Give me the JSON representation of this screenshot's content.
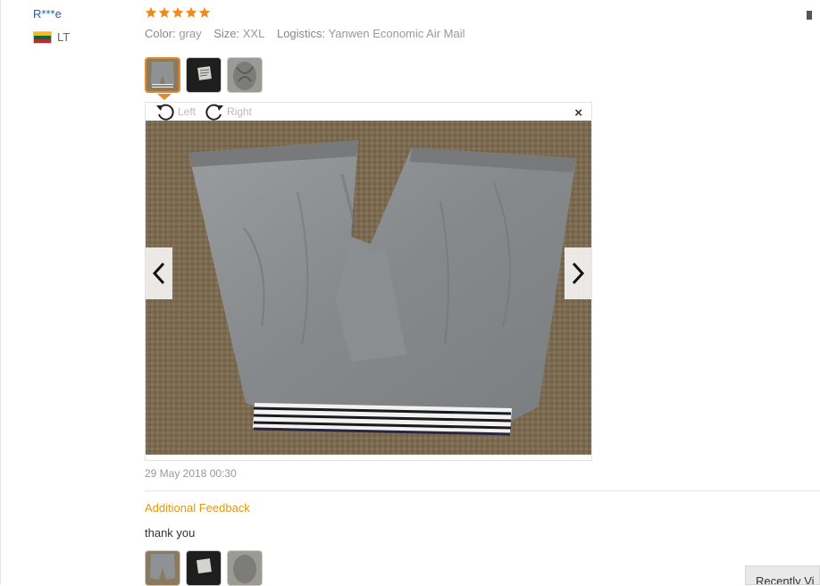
{
  "review": {
    "user_name": "R***e",
    "country_code": "LT",
    "rating_stars": 5,
    "color_label": "Color:",
    "color_value": "gray",
    "size_label": "Size:",
    "size_value": "XXL",
    "logistics_label": "Logistics:",
    "logistics_value": "Yanwen Economic Air Mail",
    "date": "29 May 2018 00:30"
  },
  "viewer": {
    "rotate_left_label": "Left",
    "rotate_right_label": "Right",
    "close_glyph": "×"
  },
  "additional_feedback": {
    "heading": "Additional Feedback",
    "text": "thank you"
  },
  "recently_viewed": {
    "label": "Recently Vi"
  },
  "colors": {
    "accent_orange": "#e58a2b",
    "star_orange": "#f08a1e",
    "username_blue": "#1e5fa8",
    "feedback_heading": "#e5980f",
    "lithuania_flag": [
      "#fdb913",
      "#006a44",
      "#c1272d"
    ]
  },
  "icons": {
    "rotate_left": "rotate-left-icon",
    "rotate_right": "rotate-right-icon",
    "prev": "chevron-left-icon",
    "next": "chevron-right-icon",
    "close": "close-icon"
  }
}
